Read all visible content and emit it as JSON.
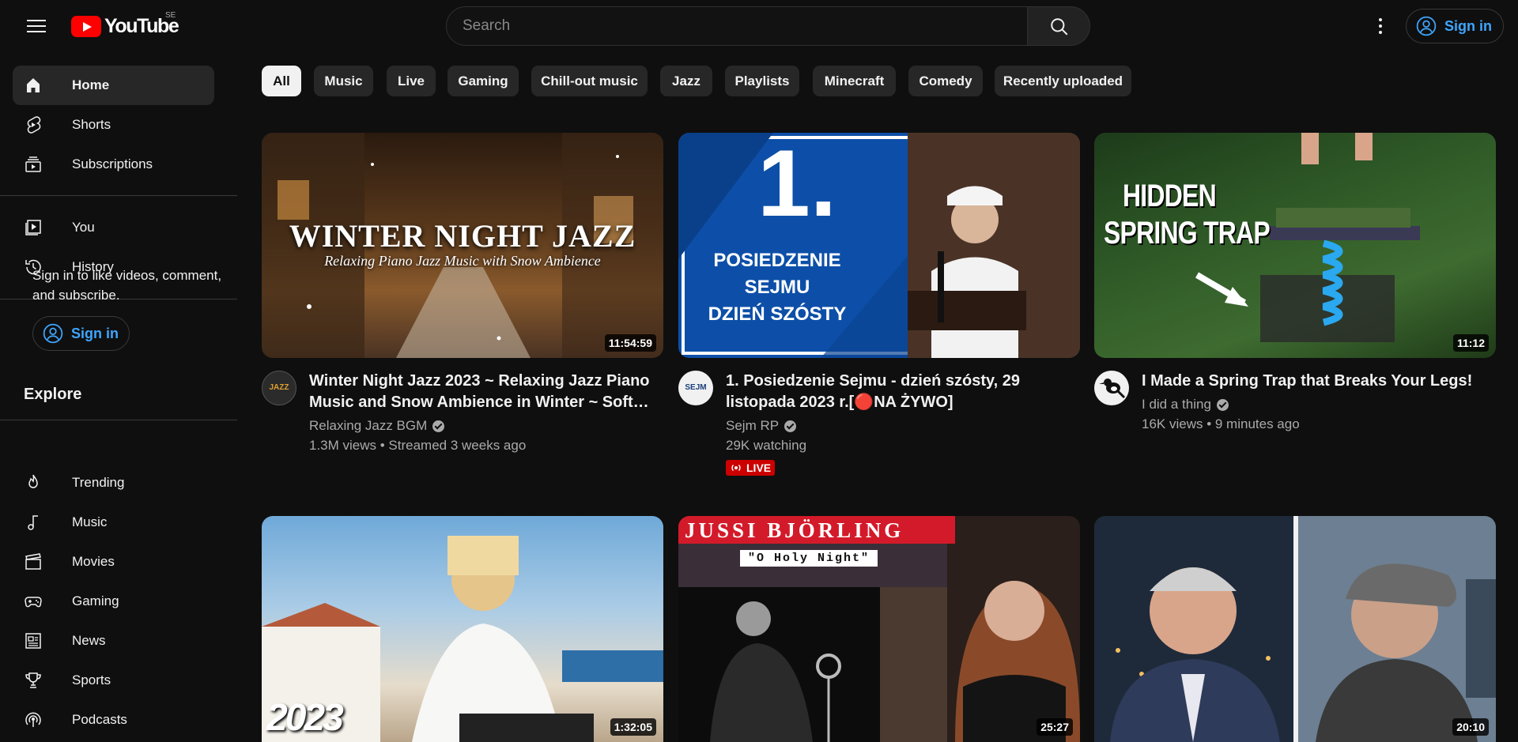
{
  "header": {
    "logo_text": "YouTube",
    "country_code": "SE",
    "search_placeholder": "Search",
    "signin_label": "Sign in"
  },
  "sidebar": {
    "primary": [
      {
        "label": "Home",
        "icon": "home-icon",
        "active": true
      },
      {
        "label": "Shorts",
        "icon": "shorts-icon"
      },
      {
        "label": "Subscriptions",
        "icon": "subscriptions-icon"
      }
    ],
    "secondary": [
      {
        "label": "You",
        "icon": "you-icon"
      },
      {
        "label": "History",
        "icon": "history-icon"
      }
    ],
    "signin_prompt": "Sign in to like videos, comment, and subscribe.",
    "signin_label": "Sign in",
    "explore_title": "Explore",
    "explore": [
      {
        "label": "Trending",
        "icon": "trending-icon"
      },
      {
        "label": "Music",
        "icon": "music-icon"
      },
      {
        "label": "Movies",
        "icon": "movies-icon"
      },
      {
        "label": "Gaming",
        "icon": "gaming-icon"
      },
      {
        "label": "News",
        "icon": "news-icon"
      },
      {
        "label": "Sports",
        "icon": "sports-icon"
      },
      {
        "label": "Podcasts",
        "icon": "podcasts-icon"
      }
    ]
  },
  "chips": [
    "All",
    "Music",
    "Live",
    "Gaming",
    "Chill-out music",
    "Jazz",
    "Playlists",
    "Minecraft",
    "Comedy",
    "Recently uploaded"
  ],
  "videos": [
    {
      "title": "Winter Night Jazz 2023 ~ Relaxing Jazz Piano Music and Snow Ambience in Winter ~ Soft…",
      "channel": "Relaxing Jazz BGM",
      "verified": true,
      "meta": "1.3M views • Streamed 3 weeks ago",
      "duration": "11:54:59",
      "thumb_text": "WINTER NIGHT JAZZ",
      "thumb_subtext": "Relaxing Piano Jazz Music with Snow Ambience",
      "avatar_text": "JAZZ"
    },
    {
      "title": "1. Posiedzenie Sejmu - dzień szósty, 29 listopada 2023 r.[🔴NA ŻYWO]",
      "channel": "Sejm RP",
      "verified": true,
      "meta": "29K watching",
      "live_label": "LIVE",
      "thumb_number": "1.",
      "thumb_lines": [
        "POSIEDZENIE",
        "SEJMU",
        "DZIEŃ SZÓSTY"
      ],
      "avatar_text": "SEJM"
    },
    {
      "title": "I Made a Spring Trap that Breaks Your Legs!",
      "channel": "I did a thing",
      "verified": true,
      "meta": "16K views • 9 minutes ago",
      "duration": "11:12",
      "thumb_lines": [
        "HIDDEN",
        "SPRING TRAP"
      ]
    },
    {
      "duration": "1:32:05",
      "thumb_text": "2023"
    },
    {
      "duration": "25:27",
      "thumb_text": "JUSSI BJÖRLING",
      "thumb_subtext": "\"O Holy Night\""
    },
    {
      "duration": "20:10"
    }
  ],
  "colors": {
    "background": "#0f0f0f",
    "chip_bg": "#272727",
    "accent_blue": "#3ea6ff",
    "brand_red": "#ff0000",
    "live_red": "#cc0000",
    "secondary_text": "#aaaaaa"
  }
}
